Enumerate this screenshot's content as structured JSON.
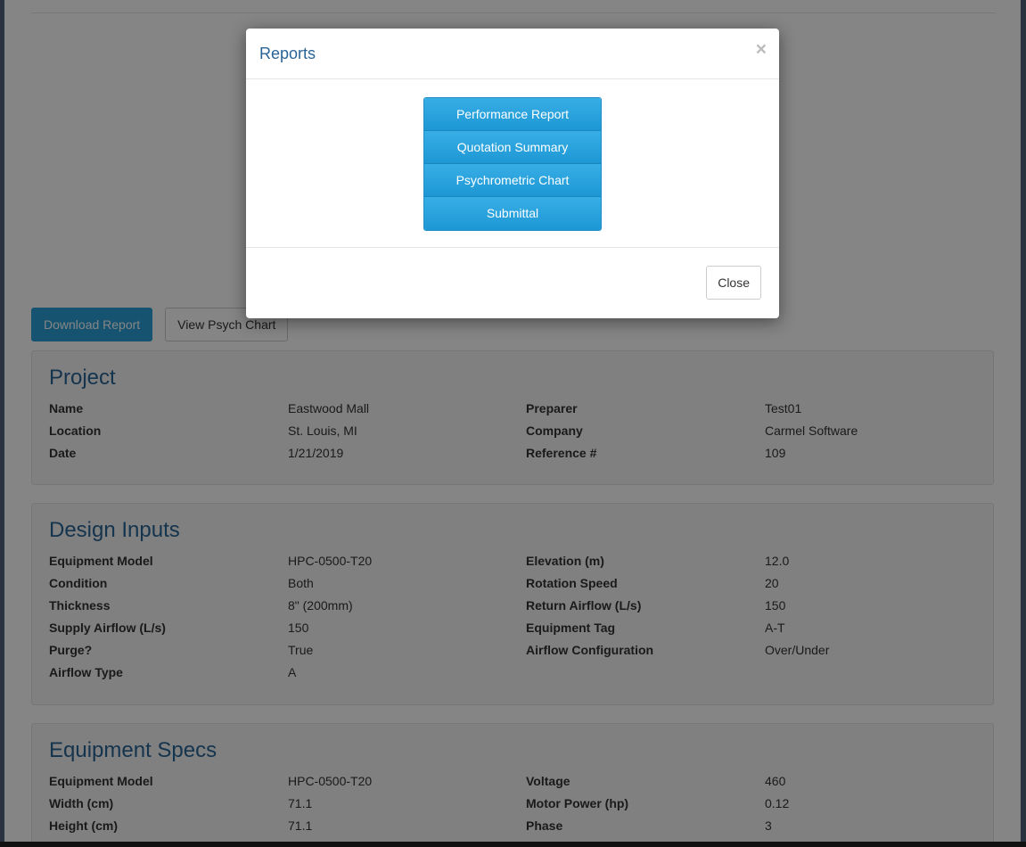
{
  "buttons": {
    "download": "Download Report",
    "psych": "View Psych Chart"
  },
  "project": {
    "title": "Project",
    "rows": [
      [
        "Name",
        "Eastwood Mall",
        "Preparer",
        "Test01"
      ],
      [
        "Location",
        "St. Louis, MI",
        "Company",
        "Carmel Software"
      ],
      [
        "Date",
        "1/21/2019",
        "Reference #",
        "109"
      ]
    ]
  },
  "design": {
    "title": "Design Inputs",
    "rows": [
      [
        "Equipment Model",
        "HPC-0500-T20",
        "Elevation (m)",
        "12.0"
      ],
      [
        "Condition",
        "Both",
        "Rotation Speed",
        "20"
      ],
      [
        "Thickness",
        "8\" (200mm)",
        "Return Airflow (L/s)",
        "150"
      ],
      [
        "Supply Airflow (L/s)",
        "150",
        "Equipment Tag",
        "A-T"
      ],
      [
        "Purge?",
        "True",
        "Airflow Configuration",
        "Over/Under"
      ],
      [
        "Airflow Type",
        "A",
        "",
        ""
      ]
    ]
  },
  "specs": {
    "title": "Equipment Specs",
    "rows": [
      [
        "Equipment Model",
        "HPC-0500-T20",
        "Voltage",
        "460"
      ],
      [
        "Width (cm)",
        "71.1",
        "Motor Power (hp)",
        "0.12"
      ],
      [
        "Height (cm)",
        "71.1",
        "Phase",
        "3"
      ]
    ]
  },
  "modal": {
    "title": "Reports",
    "close_x": "×",
    "items": [
      "Performance Report",
      "Quotation Summary",
      "Psychrometric Chart",
      "Submittal"
    ],
    "close_label": "Close"
  }
}
